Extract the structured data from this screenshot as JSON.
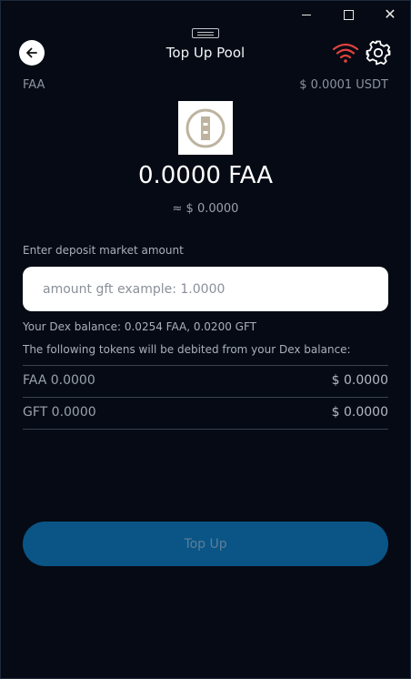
{
  "window": {
    "minimize_icon": "minimize-icon",
    "maximize_icon": "maximize-icon",
    "close_glyph": "✕"
  },
  "header": {
    "title": "Top Up Pool",
    "back_icon": "arrow-left-icon",
    "wifi_icon": "wifi-icon",
    "settings_icon": "gear-icon",
    "wifi_color": "#e0433f"
  },
  "token": {
    "symbol": "FAA",
    "price": "$ 0.0001 USDT",
    "amount": "0.0000 FAA",
    "usd_value": "≈ $ 0.0000"
  },
  "deposit": {
    "label": "Enter deposit market amount",
    "placeholder": "amount gft example: 1.0000",
    "value": ""
  },
  "balances": {
    "dex_balance": "Your Dex balance: 0.0254 FAA, 0.0200 GFT",
    "debit_note": "The following tokens will be debited from your Dex balance:",
    "rows": [
      {
        "label": "FAA 0.0000",
        "value": "$ 0.0000"
      },
      {
        "label": "GFT 0.0000",
        "value": "$ 0.0000"
      }
    ]
  },
  "actions": {
    "top_up_label": "Top Up"
  },
  "colors": {
    "background": "#050a14",
    "primary_button": "#0a5586",
    "logo_gold": "#bdb39f"
  }
}
